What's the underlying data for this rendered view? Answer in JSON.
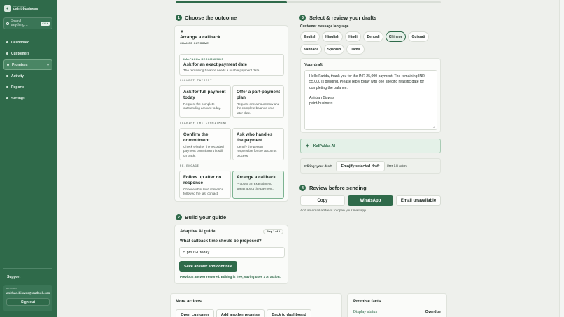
{
  "brand": {
    "small": "KALPAKKA",
    "name": "paint-business"
  },
  "search": {
    "text": "Search anything…",
    "shortcut": "Ctrl K"
  },
  "nav": [
    {
      "label": "Dashboard",
      "active": false
    },
    {
      "label": "Customers",
      "active": false
    },
    {
      "label": "Promises",
      "active": true
    },
    {
      "label": "Activity",
      "active": false
    },
    {
      "label": "Reports",
      "active": false
    },
    {
      "label": "Settings",
      "active": false
    }
  ],
  "support": "Support",
  "account": {
    "label": "ACCOUNT",
    "email": "anirban.biswas@outlook.com",
    "signout": "Sign out"
  },
  "progress": 0.42,
  "outcome": {
    "step": "1",
    "title": "Choose the outcome",
    "selected_marker": "▼",
    "selected_title": "Arrange a callback",
    "change_link": "CHANGE OUTCOME",
    "rec": {
      "label": "KALPAKKA RECOMMENDS",
      "title": "Ask for an exact payment date",
      "desc": "The remaining balance needs a usable payment date."
    },
    "groups": [
      {
        "heading": "COLLECT PAYMENT",
        "options": [
          {
            "title": "Ask for full payment today",
            "desc": "Request the complete outstanding amount today."
          },
          {
            "title": "Offer a part-payment plan",
            "desc": "Request one amount now and the complete balance on a later date."
          }
        ]
      },
      {
        "heading": "CLARIFY THE COMMITMENT",
        "options": [
          {
            "title": "Confirm the commitment",
            "desc": "Check whether the recorded payment commitment is still on track."
          },
          {
            "title": "Ask who handles the payment",
            "desc": "Identify the person responsible for the accounts process."
          }
        ]
      },
      {
        "heading": "RE-ENGAGE",
        "options": [
          {
            "title": "Follow up after no response",
            "desc": "Choose what kind of silence followed the last contact."
          },
          {
            "title": "Arrange a callback",
            "desc": "Propose an exact time to speak about the payment."
          }
        ]
      }
    ]
  },
  "guide": {
    "step": "2",
    "title": "Build your guide",
    "card_title": "Adaptive AI guide",
    "step_badge": "Step 1 of 2",
    "question": "What callback time should be proposed?",
    "answer": "5 pm  IST today",
    "save_button": "Save answer and continue",
    "note": "Previous answer restored. Editing is free; saving uses 1 AI action."
  },
  "drafts": {
    "step": "3",
    "title": "Select & review your drafts",
    "language_label": "Customer message language",
    "languages": [
      {
        "label": "English",
        "selected": false
      },
      {
        "label": "Hinglish",
        "selected": false
      },
      {
        "label": "Hindi",
        "selected": false
      },
      {
        "label": "Bengali",
        "selected": false
      },
      {
        "label": "Chinese",
        "selected": true
      },
      {
        "label": "Gujarati",
        "selected": false
      },
      {
        "label": "Kannada",
        "selected": false
      },
      {
        "label": "Spanish",
        "selected": false
      },
      {
        "label": "Tamil",
        "selected": false
      }
    ],
    "your_draft_label": "Your draft",
    "draft_body": "Hello Farida, thank you for the INR 25,000 payment. The remaining INR 55,000 is pending. Please reply today with one specific realistic date for completing the balance.",
    "draft_signature": "Anirban Biswas\npaint-business",
    "ai_label": "KalPakka AI",
    "editing_label": "Editing: your draft",
    "emojify_button": "Emojify selected draft",
    "ai_cost": "Uses 1 AI action."
  },
  "review": {
    "step": "4",
    "title": "Review before sending",
    "copy": "Copy",
    "whatsapp": "WhatsApp",
    "email": "Email unavailable",
    "hint": "Add an email address to open your mail app."
  },
  "more": {
    "title": "More actions",
    "buttons": [
      "Open customer",
      "Add another promise",
      "Back to dashboard"
    ]
  },
  "facts": {
    "title": "Promise facts",
    "label": "Display status",
    "value": "Overdue"
  },
  "colors": {
    "accent": "#2f6a4a",
    "sidebar": "#2f6a4a",
    "ai_panel": "#e4f1e8"
  }
}
